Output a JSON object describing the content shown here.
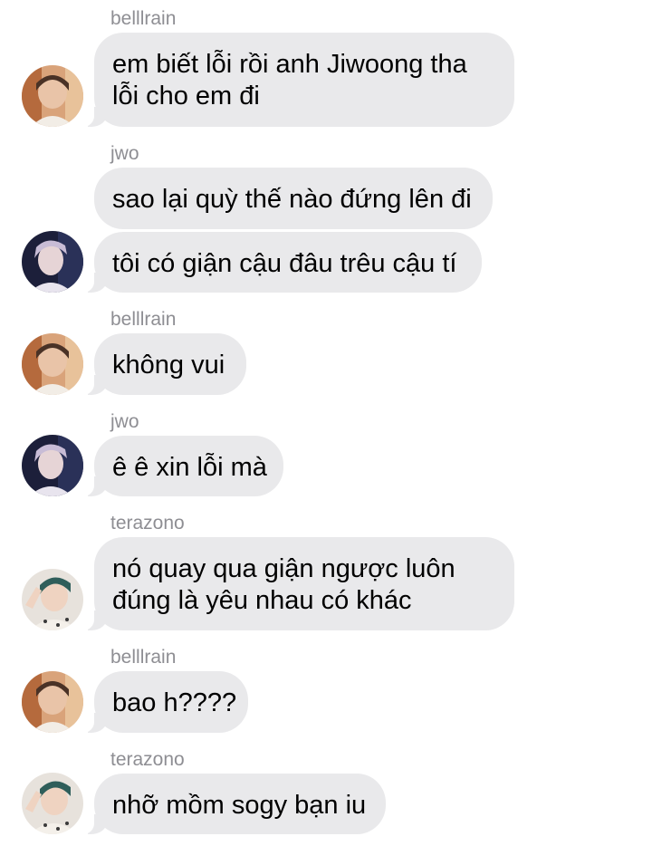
{
  "messages": [
    {
      "sender": "belllrain",
      "lines": [
        "em biết lỗi rồi anh Jiwoong tha",
        "lỗi cho em đi"
      ]
    },
    {
      "sender": "jwo",
      "lines": [
        "sao lại quỳ thế nào đứng lên đi"
      ]
    },
    {
      "sender": "",
      "lines": [
        "tôi có giận cậu đâu trêu cậu tí"
      ]
    },
    {
      "sender": "belllrain",
      "lines": [
        "không vui"
      ]
    },
    {
      "sender": "jwo",
      "lines": [
        "ê ê xin lỗi mà"
      ]
    },
    {
      "sender": "terazono",
      "lines": [
        "nó quay qua giận ngược luôn",
        "đúng là yêu nhau có khác"
      ]
    },
    {
      "sender": "belllrain",
      "lines": [
        "bao h????"
      ]
    },
    {
      "sender": "terazono",
      "lines": [
        "nhỡ mồm sogy bạn iu"
      ]
    }
  ],
  "avatars": [
    "belllrain-avatar",
    "jwo-avatar",
    "terazono-avatar"
  ],
  "colors": {
    "bubble": "#e9e9eb",
    "sender_name": "#8e8e93",
    "text": "#000000",
    "background": "#ffffff"
  }
}
